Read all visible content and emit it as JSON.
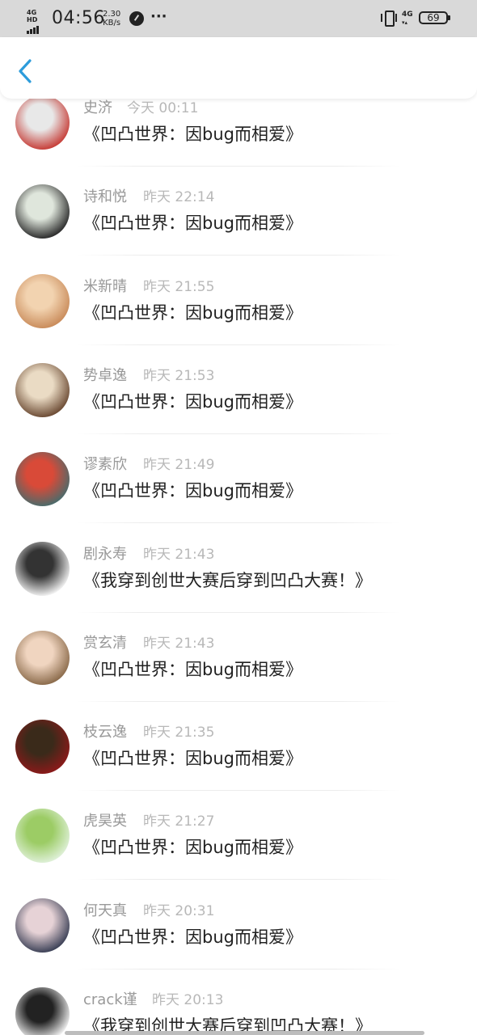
{
  "status_bar": {
    "network": "4G HD",
    "time": "04:56",
    "speed_value": "2.30",
    "speed_unit": "KB/s",
    "more": "···",
    "network_right": "4G",
    "battery": "69"
  },
  "header": {
    "back_icon": "chevron-left-icon",
    "accent_color": "#2d9cdb"
  },
  "comments": [
    {
      "name": "史济",
      "time": "今天 00:11",
      "message": "《凹凸世界：因bug而相爱》",
      "avatar_colors": [
        "#c63c36",
        "#e8e8e8"
      ]
    },
    {
      "name": "诗和悦",
      "time": "昨天 22:14",
      "message": "《凹凸世界：因bug而相爱》",
      "avatar_colors": [
        "#2a2a2a",
        "#dfe6dc"
      ]
    },
    {
      "name": "米新晴",
      "time": "昨天 21:55",
      "message": "《凹凸世界：因bug而相爱》",
      "avatar_colors": [
        "#c98b5a",
        "#f2d3b0"
      ]
    },
    {
      "name": "势卓逸",
      "time": "昨天 21:53",
      "message": "《凹凸世界：因bug而相爱》",
      "avatar_colors": [
        "#6b4a33",
        "#eadbc4"
      ]
    },
    {
      "name": "谬素欣",
      "time": "昨天 21:49",
      "message": "《凹凸世界：因bug而相爱》",
      "avatar_colors": [
        "#4a6b6b",
        "#d94a38"
      ]
    },
    {
      "name": "剧永寿",
      "time": "昨天 21:43",
      "message": "《我穿到创世大赛后穿到凹凸大赛！》",
      "avatar_colors": [
        "#f4f4f4",
        "#333333"
      ]
    },
    {
      "name": "赏玄清",
      "time": "昨天 21:43",
      "message": "《凹凸世界：因bug而相爱》",
      "avatar_colors": [
        "#8a6a4a",
        "#f0d5c0"
      ]
    },
    {
      "name": "枝云逸",
      "time": "昨天 21:35",
      "message": "《凹凸世界：因bug而相爱》",
      "avatar_colors": [
        "#8b1a1a",
        "#3a2a1a"
      ]
    },
    {
      "name": "虎昊英",
      "time": "昨天 21:27",
      "message": "《凹凸世界：因bug而相爱》",
      "avatar_colors": [
        "#dff0d8",
        "#9ccc65"
      ]
    },
    {
      "name": "何天真",
      "time": "昨天 20:31",
      "message": "《凹凸世界：因bug而相爱》",
      "avatar_colors": [
        "#3a3f55",
        "#e6d2d6"
      ]
    },
    {
      "name": "crack谨",
      "time": "昨天 20:13",
      "message": "《我穿到创世大赛后穿到凹凸大赛！》",
      "avatar_colors": [
        "#f5f5f5",
        "#222222"
      ]
    }
  ]
}
